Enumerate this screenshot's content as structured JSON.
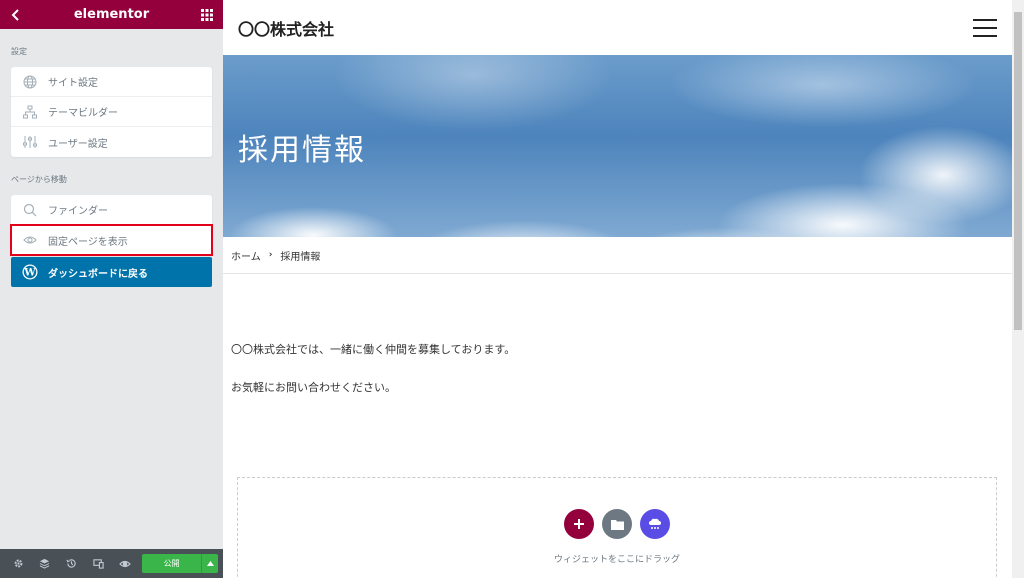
{
  "panel": {
    "header_title": "elementor",
    "section_settings": "設定",
    "settings_items": [
      {
        "label": "サイト設定",
        "icon": "globe-icon"
      },
      {
        "label": "テーマビルダー",
        "icon": "sitemap-icon"
      },
      {
        "label": "ユーザー設定",
        "icon": "sliders-icon"
      }
    ],
    "section_navigate": "ページから移動",
    "navigate_items": [
      {
        "label": "ファインダー",
        "icon": "search-icon"
      },
      {
        "label": "固定ページを表示",
        "icon": "eye-icon"
      }
    ],
    "dashboard_label": "ダッシュボードに戻る",
    "publish_label": "公開",
    "colors": {
      "header": "#93003c",
      "dashboard": "#0073aa",
      "publish": "#39b54a",
      "highlight": "#e2001a"
    }
  },
  "preview": {
    "site_title": "〇〇株式会社",
    "hero_title": "採用情報",
    "breadcrumb": {
      "home": "ホーム",
      "current": "採用情報"
    },
    "paragraph1": "〇〇株式会社では、一緒に働く仲間を募集しております。",
    "paragraph2": "お気軽にお問い合わせください。",
    "dropzone_text": "ウィジェットをここにドラッグ",
    "dropzone_colors": {
      "add": "#93003c",
      "template": "#6d7882",
      "kit": "#5a4de6"
    }
  }
}
